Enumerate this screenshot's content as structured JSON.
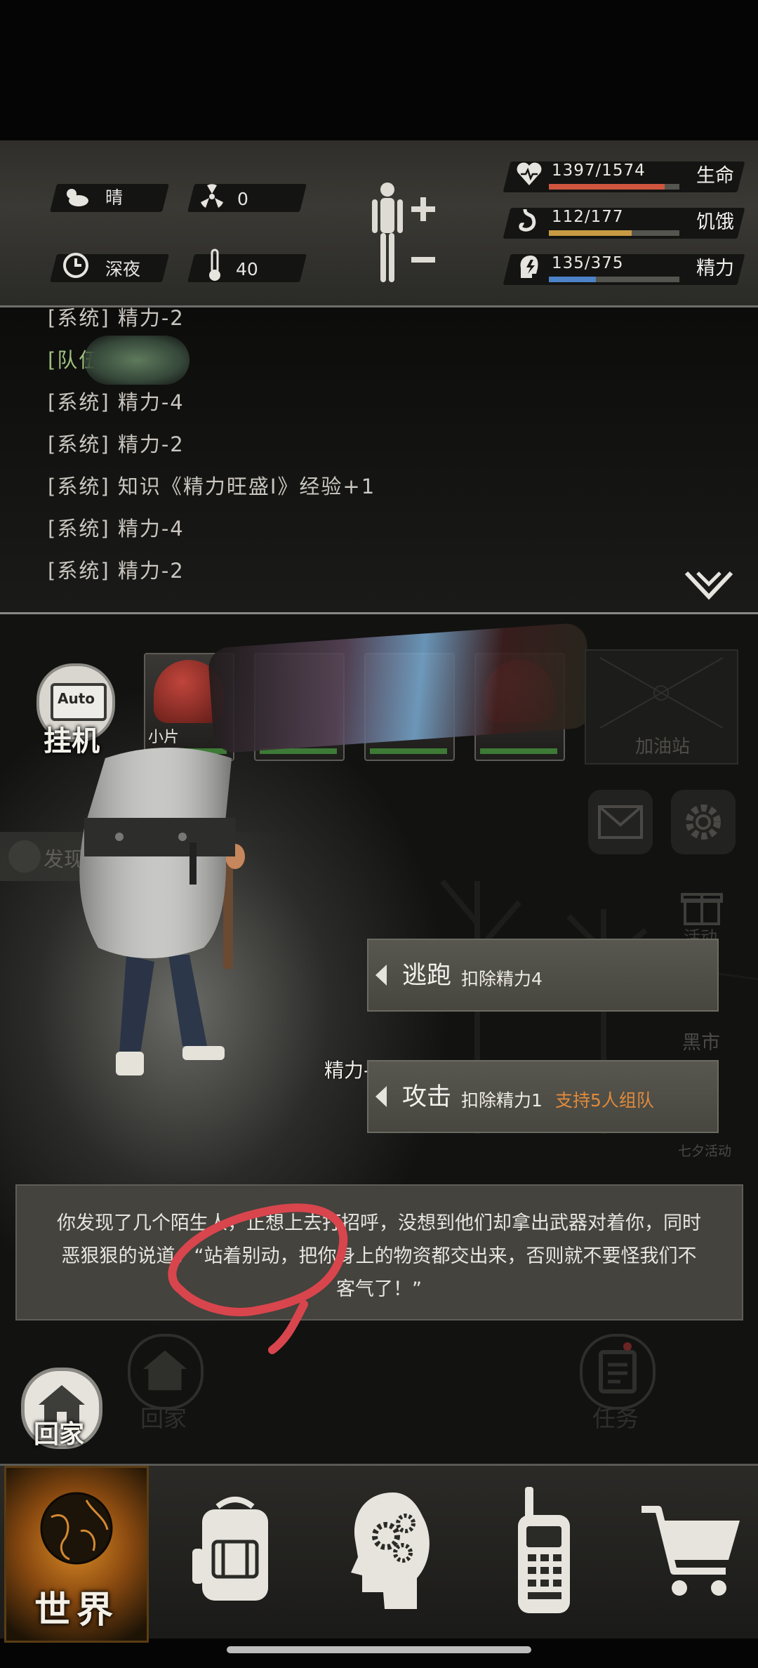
{
  "status": {
    "weather": {
      "icon": "cloudy-sun-icon",
      "label": "晴"
    },
    "radiation": {
      "icon": "radiation-icon",
      "value": "0"
    },
    "time": {
      "icon": "clock-icon",
      "label": "深夜"
    },
    "temperature": {
      "icon": "thermometer-icon",
      "value": "40"
    },
    "body_icon": "body-figure-icon",
    "health": {
      "current": "1397",
      "max": "1574",
      "text": "1397/1574",
      "label": "生命",
      "fraction": 0.888,
      "color": "#d0553f"
    },
    "hunger": {
      "current": "112",
      "max": "177",
      "text": "112/177",
      "label": "饥饿",
      "fraction": 0.633,
      "color": "#c79a43"
    },
    "stamina": {
      "current": "135",
      "max": "375",
      "text": "135/375",
      "label": "精力",
      "fraction": 0.36,
      "color": "#4c82c8"
    }
  },
  "log": {
    "lines": [
      {
        "text": "[系统] 精力-2",
        "kind": "system"
      },
      {
        "text": "[队伍]",
        "kind": "team"
      },
      {
        "text": "[系统] 精力-4",
        "kind": "system"
      },
      {
        "text": "[系统] 精力-2",
        "kind": "system"
      },
      {
        "text": "[系统] 知识《精力旺盛Ⅰ》经验+1",
        "kind": "system"
      },
      {
        "text": "[系统] 精力-4",
        "kind": "system"
      },
      {
        "text": "[系统] 精力-2",
        "kind": "system"
      }
    ],
    "collapse_icon": "double-chevron-down-icon"
  },
  "scene": {
    "auto_label": "Auto",
    "idle_label": "挂机",
    "team_first_name": "小片",
    "gas_station_label": "加油站",
    "discovered_label": "发现大",
    "gift_label": "活动",
    "black_market_label": "黑市",
    "event_label": "七夕活动",
    "damage_text": "精力-2",
    "actions": [
      {
        "label": "逃跑",
        "desc": "扣除精力4",
        "extra": ""
      },
      {
        "label": "攻击",
        "desc": "扣除精力1",
        "extra": "支持5人组队"
      }
    ]
  },
  "dialog": {
    "text": "你发现了几个陌生人，正想上去打招呼，没想到他们却拿出武器对着你，同时恶狠狠的说道：“站着别动，把你身上的物资都交出来，否则就不要怪我们不客气了！”"
  },
  "home": {
    "label": "回家",
    "ghost_label": "回家",
    "task_label": "任务"
  },
  "nav": {
    "world_label": "世界",
    "tabs": [
      "backpack-icon",
      "skills-head-icon",
      "radio-icon",
      "shop-cart-icon"
    ]
  }
}
